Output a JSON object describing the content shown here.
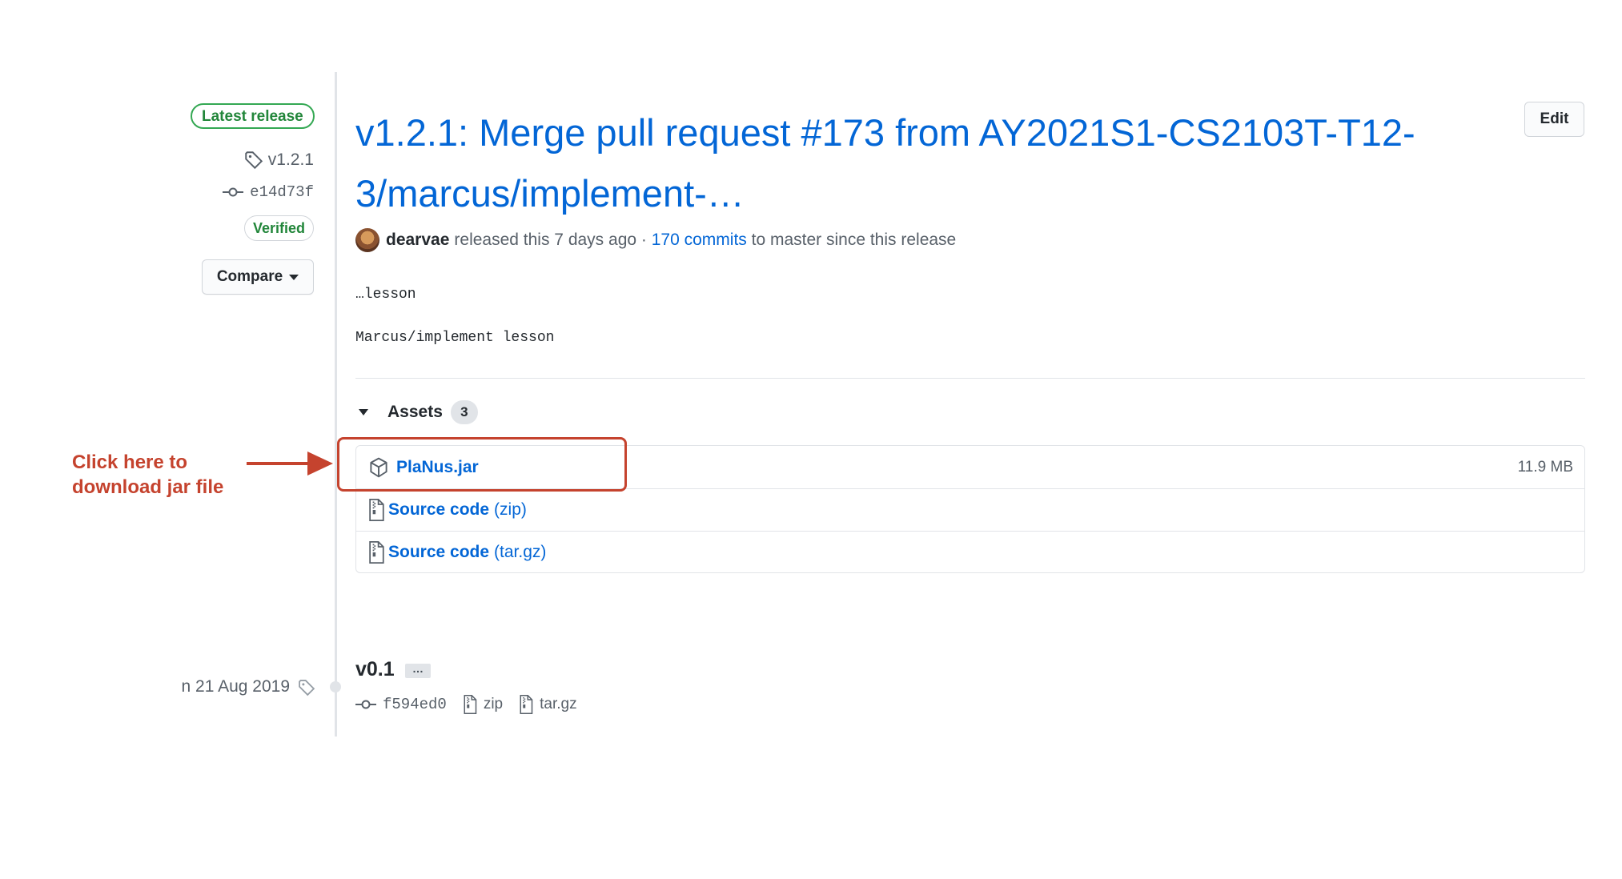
{
  "sidebar": {
    "latest_badge": "Latest release",
    "tag": "v1.2.1",
    "commit": "e14d73f",
    "verified": "Verified",
    "compare_label": "Compare"
  },
  "release": {
    "title": "v1.2.1: Merge pull request #173 from AY2021S1-CS2103T-T12-3/marcus/implement-…",
    "edit_label": "Edit",
    "author": "dearvae",
    "released_text": "released this 7 days ago ·",
    "commits_link": "170 commits",
    "commits_suffix": "to master since this release",
    "body_lines": [
      "…lesson",
      "Marcus/implement lesson"
    ]
  },
  "assets": {
    "label": "Assets",
    "count": "3",
    "items": [
      {
        "name": "PlaNus.jar",
        "ext": "",
        "size": "11.9 MB",
        "icon": "package-icon"
      },
      {
        "name": "Source code",
        "ext": "(zip)",
        "size": "",
        "icon": "file-zip-icon"
      },
      {
        "name": "Source code",
        "ext": "(tar.gz)",
        "size": "",
        "icon": "file-zip-icon"
      }
    ]
  },
  "annotation": {
    "line1": "Click here to",
    "line2": "download jar file",
    "color": "#c5432e"
  },
  "older_release": {
    "date": "n 21 Aug 2019",
    "title": "v0.1",
    "ellipsis": "…",
    "commit": "f594ed0",
    "zip": "zip",
    "targz": "tar.gz"
  },
  "colors": {
    "link": "#0366d6",
    "verified_green": "#22863a",
    "annotation_red": "#c5432e"
  }
}
